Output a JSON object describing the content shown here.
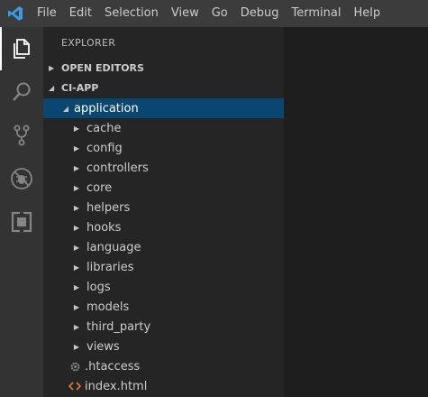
{
  "menubar": {
    "logo_icon": "vscode-logo-icon",
    "items": [
      {
        "name": "file",
        "label": "File"
      },
      {
        "name": "edit",
        "label": "Edit"
      },
      {
        "name": "selection",
        "label": "Selection"
      },
      {
        "name": "view",
        "label": "View"
      },
      {
        "name": "go",
        "label": "Go"
      },
      {
        "name": "debug",
        "label": "Debug"
      },
      {
        "name": "terminal",
        "label": "Terminal"
      },
      {
        "name": "help",
        "label": "Help"
      }
    ]
  },
  "activitybar": {
    "items": [
      {
        "name": "explorer",
        "icon": "files-icon",
        "active": true
      },
      {
        "name": "search",
        "icon": "search-icon",
        "active": false
      },
      {
        "name": "source-control",
        "icon": "source-control-icon",
        "active": false
      },
      {
        "name": "debug",
        "icon": "debug-icon",
        "active": false
      },
      {
        "name": "extensions",
        "icon": "extensions-icon",
        "active": false
      }
    ]
  },
  "sidebar": {
    "title": "EXPLORER",
    "open_editors": "OPEN EDITORS",
    "project": "CI-APP",
    "tree": [
      {
        "label": "application",
        "kind": "folder-open",
        "depth": 1,
        "selected": true
      },
      {
        "label": "cache",
        "kind": "folder",
        "depth": 2
      },
      {
        "label": "config",
        "kind": "folder",
        "depth": 2
      },
      {
        "label": "controllers",
        "kind": "folder",
        "depth": 2
      },
      {
        "label": "core",
        "kind": "folder",
        "depth": 2
      },
      {
        "label": "helpers",
        "kind": "folder",
        "depth": 2
      },
      {
        "label": "hooks",
        "kind": "folder",
        "depth": 2
      },
      {
        "label": "language",
        "kind": "folder",
        "depth": 2
      },
      {
        "label": "libraries",
        "kind": "folder",
        "depth": 2
      },
      {
        "label": "logs",
        "kind": "folder",
        "depth": 2
      },
      {
        "label": "models",
        "kind": "folder",
        "depth": 2
      },
      {
        "label": "third_party",
        "kind": "folder",
        "depth": 2
      },
      {
        "label": "views",
        "kind": "folder",
        "depth": 2
      },
      {
        "label": ".htaccess",
        "kind": "file-config",
        "depth": 2,
        "icon": "gear-icon"
      },
      {
        "label": "index.html",
        "kind": "file-html",
        "depth": 2,
        "icon": "html-code-icon"
      }
    ]
  },
  "colors": {
    "menubar_bg": "#3c3c3c",
    "activitybar_bg": "#333333",
    "sidebar_bg": "#252526",
    "editor_bg": "#1e1e1e",
    "selection_bg": "#094771",
    "logo_blue": "#3b9ae1",
    "html_icon": "#e37933",
    "gear_icon": "#8a8a8a"
  }
}
